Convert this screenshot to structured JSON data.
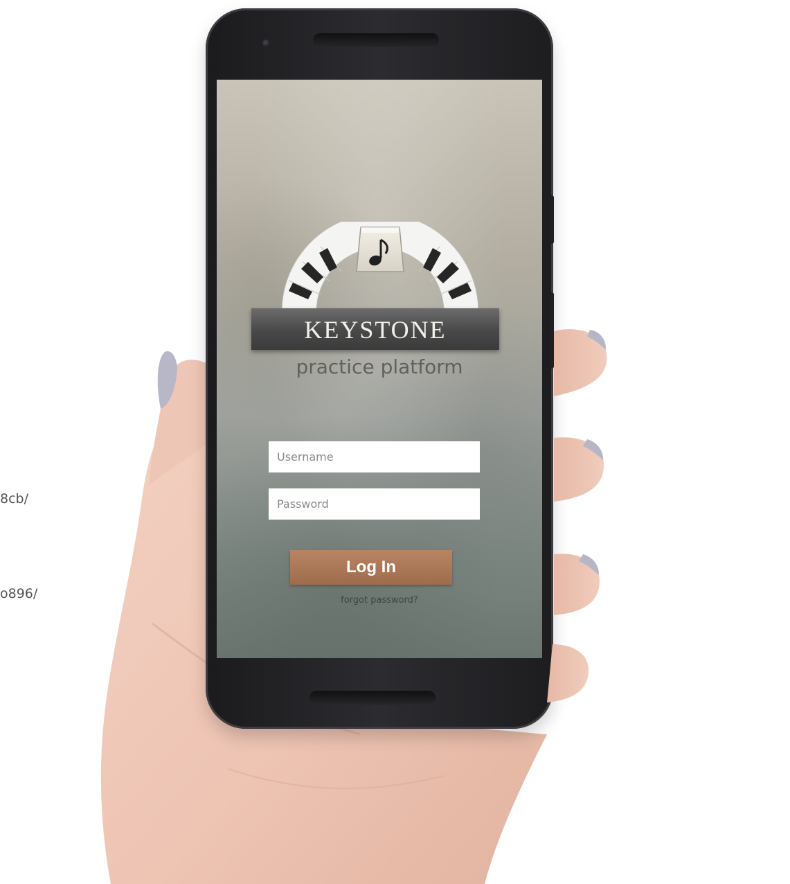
{
  "background_text": {
    "line_1": "8cb/",
    "line_2": "o896/"
  },
  "app": {
    "brand": "KEYSTONE",
    "tagline": "practice platform",
    "logo_icon": "music-note-icon",
    "username_placeholder": "Username",
    "password_placeholder": "Password",
    "login_label": "Log In",
    "forgot_label": "forgot password?"
  },
  "colors": {
    "login_button": "#a9755a",
    "brand_banner": "#4d4d4d",
    "tagline": "#5e615f",
    "phone_body": "#222226"
  }
}
